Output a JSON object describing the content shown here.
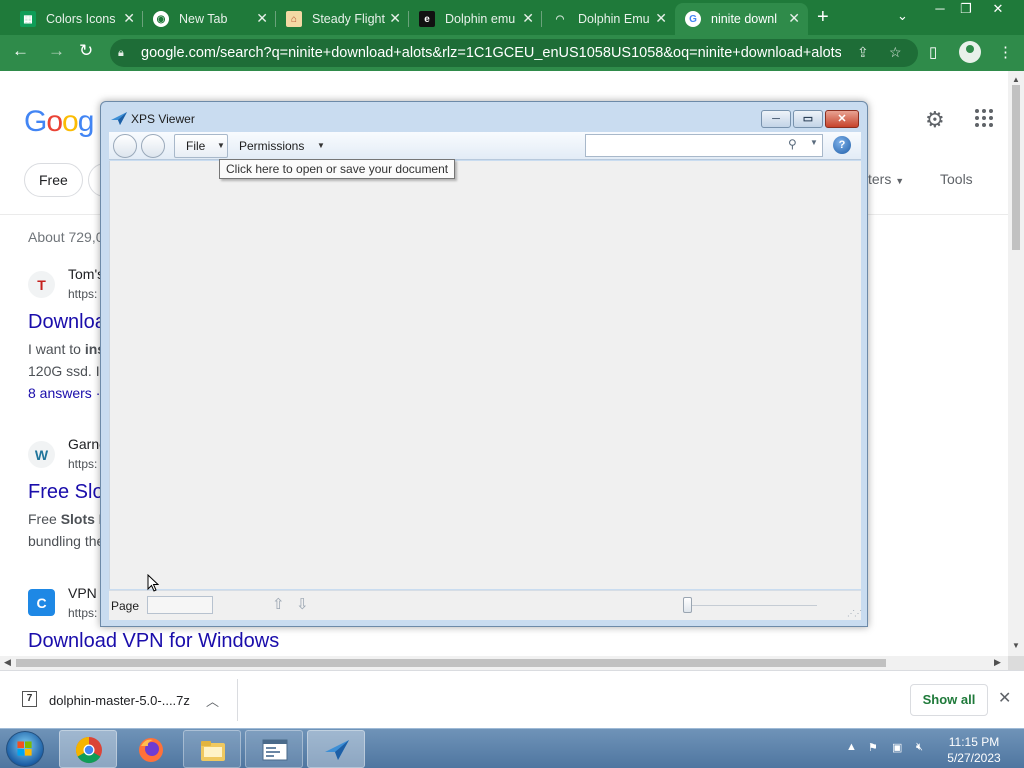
{
  "browser": {
    "tabs": [
      {
        "title": "Colors Icons",
        "favicon": "sheets-icon",
        "active": false
      },
      {
        "title": "New Tab",
        "favicon": "chrome-icon",
        "active": false
      },
      {
        "title": "Steady Flight",
        "favicon": "flight-icon",
        "active": false
      },
      {
        "title": "Dolphin emu",
        "favicon": "emu-icon",
        "active": false
      },
      {
        "title": "Dolphin Emu",
        "favicon": "dolphin-icon",
        "active": false
      },
      {
        "title": "ninite downl",
        "favicon": "google-icon",
        "active": true
      }
    ],
    "address_bar": {
      "url": "google.com/search?q=ninite+download+alots&rlz=1C1GCEU_enUS1058US1058&oq=ninite+download+alots&..."
    }
  },
  "google": {
    "logo": "Google",
    "chips": {
      "free": "Free"
    },
    "filters_label": "ters",
    "tools_label": "Tools",
    "stats": "About 729,0",
    "results": [
      {
        "icon_letter": "T",
        "site": "Tom's",
        "url": "https:",
        "title": "Downloa",
        "snippet1_pre": "I want to ",
        "snippet1_bold": "ins",
        "snippet2": "120G ssd. I",
        "more": "8 answers ·"
      },
      {
        "icon_letter": "W",
        "site": "Garne",
        "url": "https:",
        "title": "Free Slo",
        "snippet1_pre": "Free ",
        "snippet1_bold": "Slots I",
        "snippet2": "bundling the"
      },
      {
        "icon_letter": "C",
        "site": "VPN",
        "url": "https:",
        "title": "Download VPN for Windows"
      }
    ]
  },
  "xps_viewer": {
    "title": "XPS Viewer",
    "menu": {
      "file": "File",
      "permissions": "Permissions"
    },
    "tooltip": "Click here to open or save your document",
    "status": {
      "page_label": "Page",
      "page_value": ""
    },
    "search_placeholder": "",
    "help_label": "?"
  },
  "download_bar": {
    "file_name": "dolphin-master-5.0-....7z",
    "file_icon_label": "7",
    "show_all": "Show all"
  },
  "taskbar": {
    "time": "11:15 PM",
    "date": "5/27/2023"
  },
  "colors": {
    "chrome_frame": "#1f7a3a",
    "chrome_toolbar": "#2f8b4a",
    "link": "#1a0dab",
    "taskbar": "#5b80a8"
  }
}
